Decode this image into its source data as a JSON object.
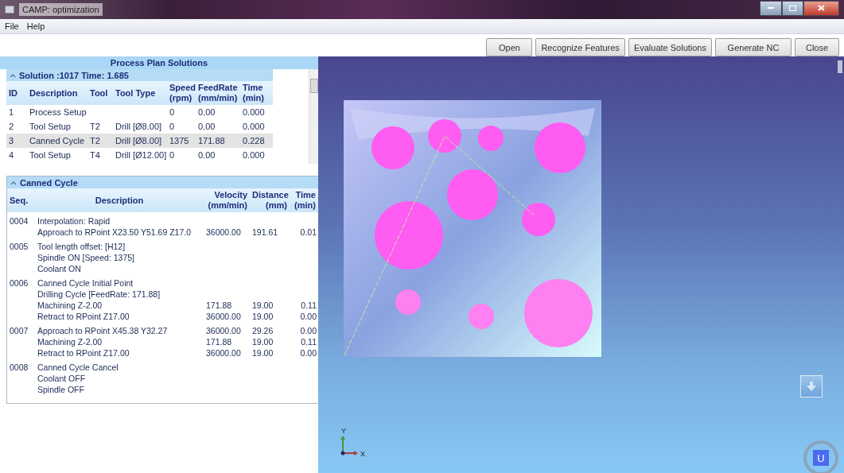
{
  "window": {
    "title": "CAMP: optimization"
  },
  "menu": [
    "File",
    "Help"
  ],
  "toolbar": [
    "Open",
    "Recognize Features",
    "Evaluate Solutions",
    "Generate NC",
    "Close"
  ],
  "solutions": {
    "title": "Process Plan Solutions",
    "group": {
      "label": "Solution :1017  Time: 1.685",
      "expanded": true
    },
    "columns": [
      "ID",
      "Description",
      "Tool",
      "Tool Type",
      "Speed (rpm)",
      "FeedRate (mm/min)",
      "Time (min)"
    ],
    "rows": [
      {
        "cells": [
          "1",
          "Process Setup",
          "",
          "",
          "0",
          "0.00",
          "0.000"
        ],
        "selected": false
      },
      {
        "cells": [
          "2",
          "Tool Setup",
          "T2",
          "Drill [Ø8.00]",
          "0",
          "0.00",
          "0.000"
        ],
        "selected": false
      },
      {
        "cells": [
          "3",
          "Canned Cycle",
          "T2",
          "Drill [Ø8.00]",
          "1375",
          "171.88",
          "0.228"
        ],
        "selected": true
      },
      {
        "cells": [
          "4",
          "Tool Setup",
          "T4",
          "Drill [Ø12.00]",
          "0",
          "0.00",
          "0.000"
        ],
        "selected": false
      }
    ]
  },
  "cycle": {
    "label": "Canned Cycle",
    "expanded": true,
    "columns": [
      "Seq.",
      "Description",
      "Velocity (mm/min)",
      "Distance (mm)",
      "Time (min)"
    ],
    "steps": [
      {
        "seq": "0004",
        "lines": [
          {
            "description": "Interpolation: Rapid"
          },
          {
            "description": "Approach to RPoint  X23.50 Y51.69 Z17.0",
            "velocity": "36000.00",
            "distance": "191.61",
            "time": "0.01"
          }
        ]
      },
      {
        "seq": "0005",
        "lines": [
          {
            "description": "Tool length offset: [H12]"
          },
          {
            "description": "Spindle ON [Speed: 1375]"
          },
          {
            "description": "Coolant ON"
          }
        ]
      },
      {
        "seq": "0006",
        "lines": [
          {
            "description": "Canned Cycle Initial Point"
          },
          {
            "description": "Drilling Cycle [FeedRate: 171.88]"
          },
          {
            "description": "Machining  Z-2.00",
            "velocity": "171.88",
            "distance": "19.00",
            "time": "0.11"
          },
          {
            "description": "Retract to RPoint  Z17.00",
            "velocity": "36000.00",
            "distance": "19.00",
            "time": "0.00"
          }
        ]
      },
      {
        "seq": "0007",
        "lines": [
          {
            "description": "Approach to RPoint  X45.38 Y32.27",
            "velocity": "36000.00",
            "distance": "29.26",
            "time": "0.00"
          },
          {
            "description": "Machining  Z-2.00",
            "velocity": "171.88",
            "distance": "19.00",
            "time": "0.11"
          },
          {
            "description": "Retract to RPoint  Z17.00",
            "velocity": "36000.00",
            "distance": "19.00",
            "time": "0.00"
          }
        ]
      },
      {
        "seq": "0008",
        "lines": [
          {
            "description": "Canned Cycle Cancel"
          },
          {
            "description": "Coolant OFF"
          },
          {
            "description": "Spindle OFF"
          }
        ]
      }
    ]
  },
  "viewport": {
    "axes": {
      "y": "Y",
      "x": "X"
    },
    "badge": "U"
  }
}
